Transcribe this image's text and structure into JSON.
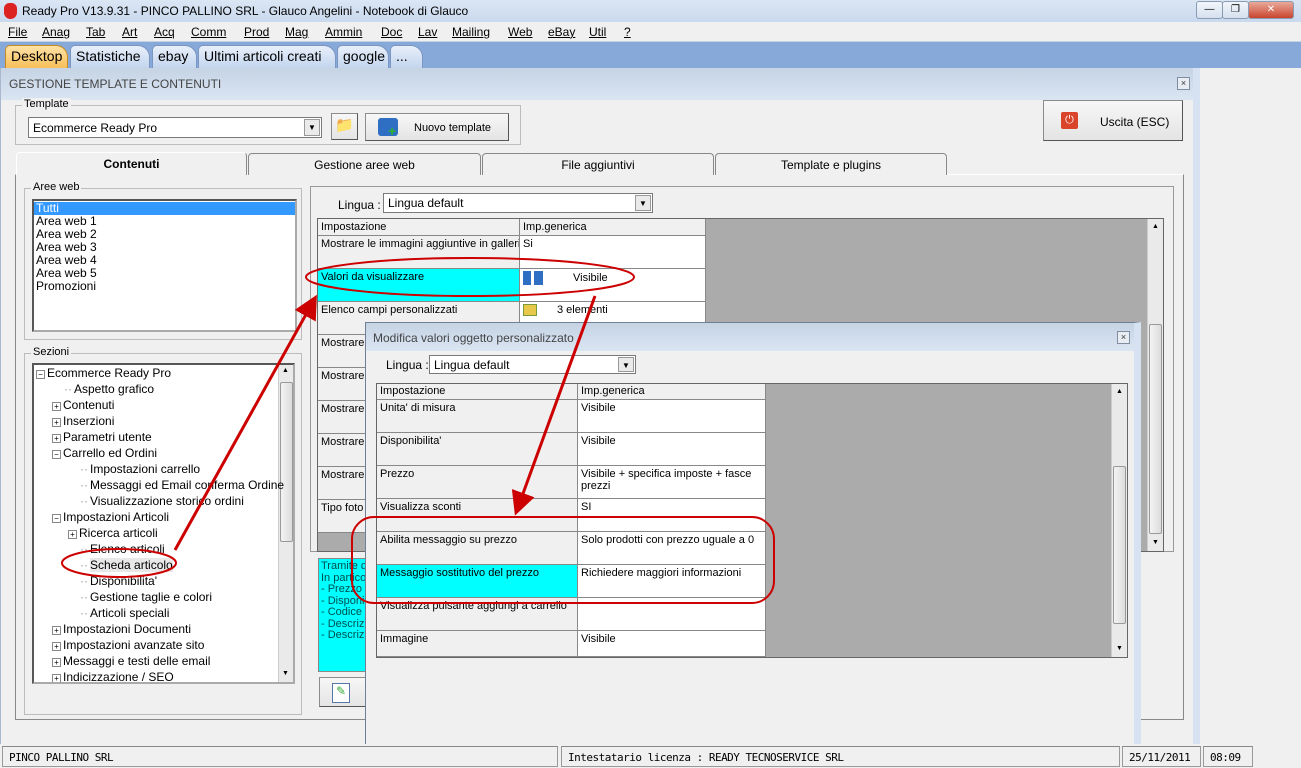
{
  "window": {
    "title": "Ready Pro V13.9.31 - PINCO PALLINO SRL - Glauco Angelini - Notebook di Glauco",
    "controls": [
      "minimize",
      "restore",
      "close"
    ]
  },
  "menu": [
    "File",
    "Anag",
    "Tab",
    "Art",
    "Acq",
    "Comm",
    "Prod",
    "Mag",
    "Ammin",
    "Doc",
    "Lav",
    "Mailing",
    "Web",
    "eBay",
    "Util",
    "?"
  ],
  "desktop_tabs": [
    "Desktop",
    "Statistiche",
    "ebay",
    "Ultimi articoli creati",
    "google",
    "..."
  ],
  "form": {
    "title": "GESTIONE TEMPLATE E CONTENUTI",
    "template_label": "Template",
    "template_value": "Ecommerce Ready Pro",
    "new_template": "Nuovo template",
    "exit": "Uscita (ESC)",
    "tabs": [
      "Contenuti",
      "Gestione aree web",
      "File aggiuntivi",
      "Template e plugins"
    ],
    "aree_web_label": "Aree web",
    "aree_web": [
      "Tutti",
      "Area web 1",
      "Area web 2",
      "Area web 3",
      "Area web 4",
      "Area web 5",
      "Promozioni"
    ],
    "sezioni_label": "Sezioni",
    "tree": [
      {
        "label": "Ecommerce Ready Pro",
        "level": 0,
        "exp": "-"
      },
      {
        "label": "Aspetto grafico",
        "level": 1,
        "exp": ""
      },
      {
        "label": "Contenuti",
        "level": 1,
        "exp": "+"
      },
      {
        "label": "Inserzioni",
        "level": 1,
        "exp": "+"
      },
      {
        "label": "Parametri utente",
        "level": 1,
        "exp": "+"
      },
      {
        "label": "Carrello ed Ordini",
        "level": 1,
        "exp": "-"
      },
      {
        "label": "Impostazioni carrello",
        "level": 2,
        "exp": ""
      },
      {
        "label": "Messaggi ed Email conferma Ordine",
        "level": 2,
        "exp": ""
      },
      {
        "label": "Visualizzazione storico ordini",
        "level": 2,
        "exp": ""
      },
      {
        "label": "Impostazioni Articoli",
        "level": 1,
        "exp": "-"
      },
      {
        "label": "Ricerca articoli",
        "level": 2,
        "exp": "+"
      },
      {
        "label": "Elenco articoli",
        "level": 2,
        "exp": ""
      },
      {
        "label": "Scheda articolo",
        "level": 2,
        "exp": ""
      },
      {
        "label": "Disponibilita'",
        "level": 2,
        "exp": ""
      },
      {
        "label": "Gestione taglie e colori",
        "level": 2,
        "exp": ""
      },
      {
        "label": "Articoli speciali",
        "level": 2,
        "exp": ""
      },
      {
        "label": "Impostazioni Documenti",
        "level": 1,
        "exp": "+"
      },
      {
        "label": "Impostazioni avanzate sito",
        "level": 1,
        "exp": "+"
      },
      {
        "label": "Messaggi e testi delle email",
        "level": 1,
        "exp": "+"
      },
      {
        "label": "Indicizzazione / SEO",
        "level": 1,
        "exp": "+"
      }
    ],
    "lingua_label": "Lingua :",
    "lingua_value": "Lingua default",
    "grid_headers": [
      "Impostazione",
      "Imp.generica"
    ],
    "grid_rows": [
      {
        "name": "Mostrare le immagini aggiuntive in galleria",
        "value": "Si"
      },
      {
        "name": "Valori da visualizzare",
        "value": "Visibile"
      },
      {
        "name": "Elenco campi personalizzati",
        "value": "3 elementi"
      },
      {
        "name": "Mostrare",
        "value": ""
      },
      {
        "name": "Mostrare",
        "value": ""
      },
      {
        "name": "Mostrare",
        "value": ""
      },
      {
        "name": "Mostrare",
        "value": ""
      },
      {
        "name": "Mostrare",
        "value": ""
      },
      {
        "name": "Tipo foto",
        "value": ""
      }
    ],
    "info_lines": [
      "Tramite q",
      "In partico",
      "- Prezzo",
      "- Disponi",
      "- Codice",
      "- Descriz",
      "- Descriz"
    ]
  },
  "dialog": {
    "title": "Modifica valori oggetto personalizzato",
    "lingua_label": "Lingua :",
    "lingua_value": "Lingua default",
    "grid_headers": [
      "Impostazione",
      "Imp.generica"
    ],
    "rows": [
      {
        "name": "Unita' di misura",
        "value": "Visibile"
      },
      {
        "name": "Disponibilita'",
        "value": "Visibile"
      },
      {
        "name": "Prezzo",
        "value": "Visibile + specifica imposte + fasce prezzi"
      },
      {
        "name": "Visualizza sconti",
        "value": "SI"
      },
      {
        "name": "Abilita messaggio su prezzo",
        "value": "Solo prodotti con prezzo uguale a 0"
      },
      {
        "name": "Messaggio sostitutivo del prezzo",
        "value": "Richiedere maggiori informazioni"
      },
      {
        "name": "Visualizza pulsante aggiungi a carrello",
        "value": ""
      },
      {
        "name": "Immagine",
        "value": "Visibile"
      }
    ]
  },
  "status": {
    "company": "PINCO PALLINO SRL",
    "license": "Intestatario licenza : READY TECNOSERVICE SRL",
    "date": "25/11/2011",
    "time": "08:09"
  },
  "colors": {
    "highlight": "#00ffff",
    "annotation": "#cc0000",
    "selection": "#3399ff"
  }
}
